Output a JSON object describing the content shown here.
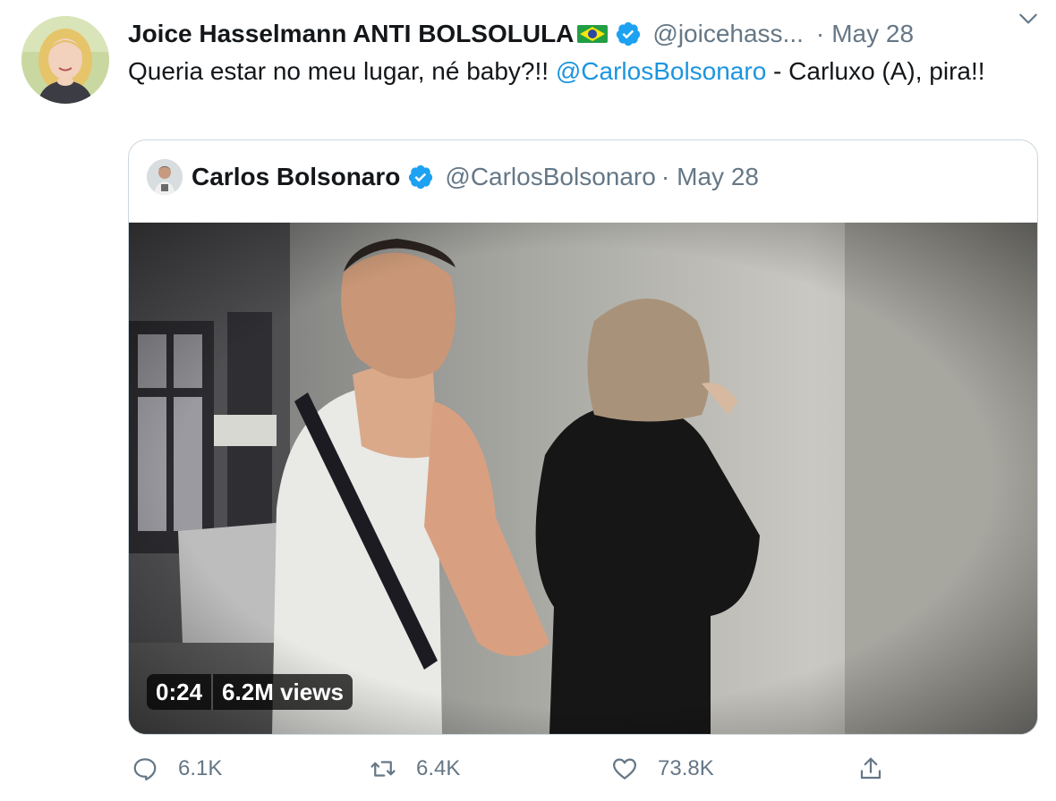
{
  "author": {
    "display_name": "Joice Hasselmann ANTI BOLSOLULA",
    "handle": "@joicehass...",
    "dot": "·",
    "date": "May 28",
    "avatar_icon": "profile-photo",
    "flag_icon": "brazil-flag-emoji",
    "verified_icon": "verified-badge-icon"
  },
  "tweet": {
    "text_before": "Queria estar no meu lugar, né baby?!! ",
    "mention": "@CarlosBolsonaro",
    "text_after": " - Carluxo (A), pira!!"
  },
  "quoted": {
    "display_name": "Carlos Bolsonaro",
    "handle": "@CarlosBolsonaro",
    "dot": "·",
    "date": "May 28",
    "video": {
      "duration": "0:24",
      "views": "6.2M views"
    }
  },
  "actions": {
    "reply_count": "6.1K",
    "retweet_count": "6.4K",
    "like_count": "73.8K"
  },
  "colors": {
    "link": "#1b95e0",
    "secondary_text": "#657786",
    "verified": "#1da1f2",
    "border": "#ccd6dd"
  }
}
